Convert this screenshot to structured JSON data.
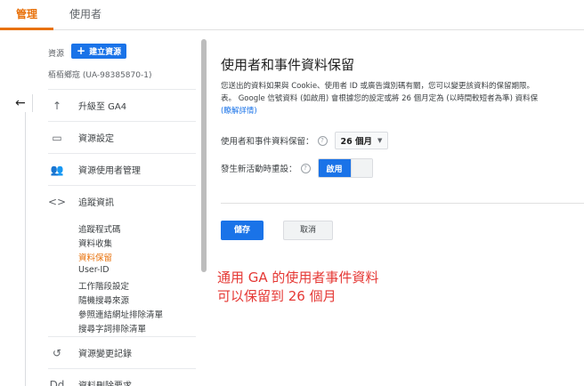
{
  "topbar": {
    "tab_admin": "管理",
    "tab_users": "使用者"
  },
  "left_nav": {
    "property_label": "資源",
    "create_button": "建立資源",
    "create_plus": "+",
    "property_name": "栢栢鄉寇 (UA-98385870-1)",
    "back_icon": "←",
    "items": [
      {
        "icon": "↑",
        "label": "升級至 GA4"
      },
      {
        "icon": "▭",
        "label": "資源設定"
      },
      {
        "icon": "👥",
        "label": "資源使用者管理"
      },
      {
        "icon": "<>",
        "label": "追蹤資訊"
      }
    ],
    "sub_items": [
      "追蹤程式碼",
      "資料收集",
      "資料保留",
      "User-ID",
      "工作階段設定",
      "隨機搜尋來源",
      "參照連結網址排除清單",
      "搜尋字詞排除清單"
    ],
    "bottom_items": [
      {
        "icon": "↺",
        "label": "資源變更記錄"
      },
      {
        "icon": "Dd",
        "label": "資料刪除要求"
      }
    ]
  },
  "main": {
    "title": "使用者和事件資料保留",
    "desc_line1": "您送出的資料如果與 Cookie、使用者 ID 或廣告識別碼有關，您可以變更該資料的保留期限。",
    "desc_line2": "表。 Google 信號資料 (如啟用) 會根據您的設定或將 26 個月定為 (以時間較短者為準) 資料保",
    "desc_link": "(瞭解詳情)",
    "retention_label": "使用者和事件資料保留：",
    "help": "?",
    "retention_value": "26 個月",
    "reset_label": "發生新活動時重設：",
    "toggle_on": "啟用",
    "save": "儲存",
    "cancel": "取消"
  },
  "annotation": {
    "line1": "通用 GA 的使用者事件資料",
    "line2": "可以保留到 26 個月"
  }
}
